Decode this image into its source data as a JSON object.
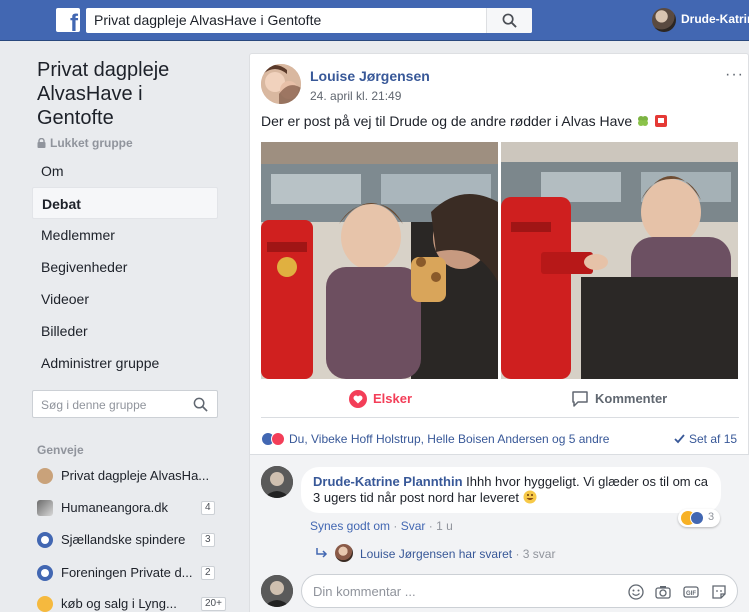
{
  "search": {
    "query": "Privat dagpleje AlvasHave i Gentofte"
  },
  "header": {
    "user_name": "Drude-Katrine"
  },
  "group": {
    "title": "Privat dagpleje AlvasHave i Gentofte",
    "privacy": "Lukket gruppe"
  },
  "nav": {
    "items": [
      {
        "label": "Om"
      },
      {
        "label": "Debat",
        "active": true
      },
      {
        "label": "Medlemmer"
      },
      {
        "label": "Begivenheder"
      },
      {
        "label": "Videoer"
      },
      {
        "label": "Billeder"
      },
      {
        "label": "Administrer gruppe"
      }
    ]
  },
  "group_search": {
    "placeholder": "Søg i denne gruppe"
  },
  "shortcuts": {
    "title": "Genveje",
    "items": [
      {
        "label": "Privat dagpleje AlvasHa...",
        "badge": "",
        "icon": "bear-icon"
      },
      {
        "label": "Humaneangora.dk",
        "badge": "4",
        "icon": "photo-icon"
      },
      {
        "label": "Sjællandske spindere",
        "badge": "3",
        "icon": "group-icon"
      },
      {
        "label": "Foreningen Private d...",
        "badge": "2",
        "icon": "group-icon"
      },
      {
        "label": "køb og salg i Lyng...",
        "badge": "20+",
        "icon": "flower-icon"
      }
    ]
  },
  "post": {
    "author": "Louise Jørgensen",
    "time": "24. april kl. 21:49",
    "menu": "···",
    "text": "Der er post på vej til Drude og de andre rødder i Alvas Have",
    "actions": {
      "love": "Elsker",
      "comment": "Kommenter"
    },
    "reactions": {
      "text": "Du, Vibeke Hoff Holstrup, Helle Boisen Andersen og 5 andre",
      "seen": "Set af 15"
    }
  },
  "comment": {
    "author": "Drude-Katrine Plannthin",
    "text": "Ihhh hvor hyggeligt. Vi glæder os til om ca 3 ugers tid når post nord har leveret",
    "reaction_count": "3",
    "like": "Synes godt om",
    "reply": "Svar",
    "time": "1 u",
    "sep": "·"
  },
  "reply_summary": {
    "text": "Louise Jørgensen har svaret",
    "sep": "·",
    "count": "3 svar"
  },
  "write_comment": {
    "placeholder": "Din kommentar ..."
  },
  "colors": {
    "brand": "#4267b2",
    "love": "#f33e58",
    "link": "#385898"
  }
}
